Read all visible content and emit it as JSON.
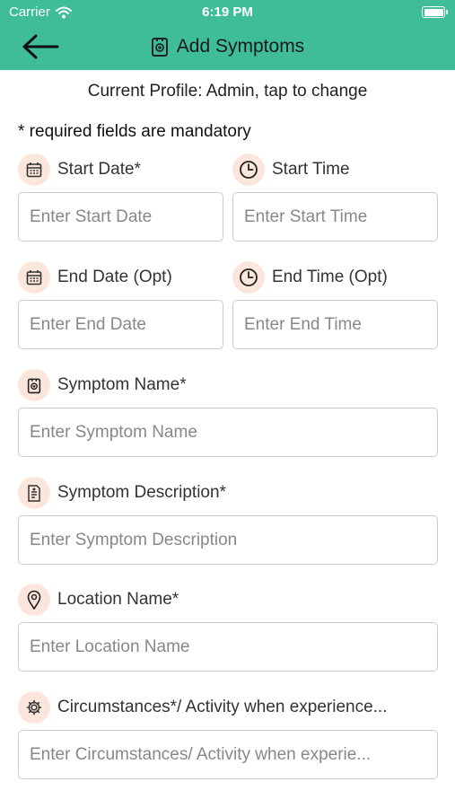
{
  "status": {
    "carrier": "Carrier",
    "time": "6:19 PM",
    "battery_level": 1.0
  },
  "header": {
    "title": "Add Symptoms",
    "back_icon": "arrow-left-icon",
    "title_icon": "symptom-icon",
    "background_color": "#3ebd98"
  },
  "profile": {
    "text": "Current Profile: Admin, tap to change"
  },
  "required_note": "* required fields are mandatory",
  "fields": {
    "start_date": {
      "label": "Start Date*",
      "placeholder": "Enter Start Date",
      "icon": "calendar-icon"
    },
    "start_time": {
      "label": "Start Time",
      "placeholder": "Enter Start Time",
      "icon": "clock-icon"
    },
    "end_date": {
      "label": "End Date (Opt)",
      "placeholder": "Enter End Date",
      "icon": "calendar-icon"
    },
    "end_time": {
      "label": "End Time (Opt)",
      "placeholder": "Enter End Time",
      "icon": "clock-icon"
    },
    "symptom_name": {
      "label": "Symptom Name*",
      "placeholder": "Enter Symptom Name",
      "icon": "symptom-icon"
    },
    "symptom_description": {
      "label": "Symptom Description*",
      "placeholder": "Enter Symptom Description",
      "icon": "document-icon"
    },
    "location_name": {
      "label": "Location Name*",
      "placeholder": "Enter Location Name",
      "icon": "location-pin-icon"
    },
    "circumstances": {
      "label": "Circumstances*/ Activity when experience...",
      "placeholder": "Enter Circumstances/ Activity when experie...",
      "icon": "gear-icon"
    }
  },
  "colors": {
    "accent": "#3ebd98",
    "icon_bg": "#fbe6db"
  }
}
